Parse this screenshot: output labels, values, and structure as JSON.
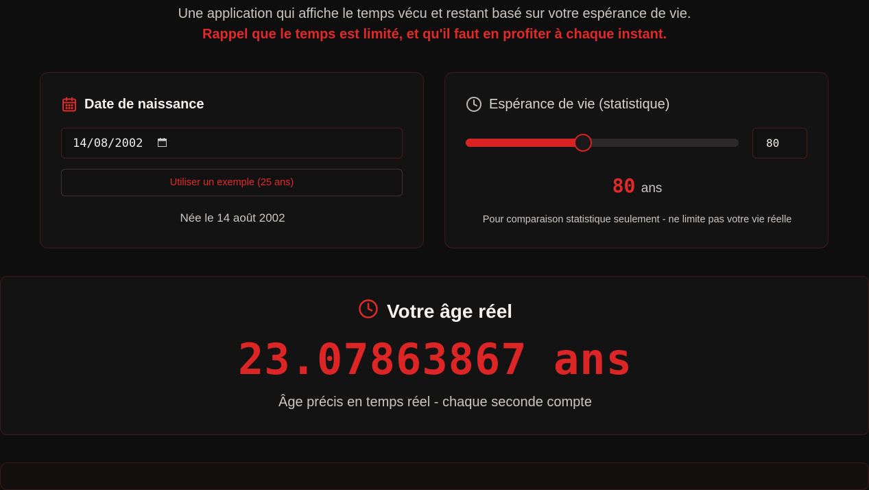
{
  "intro": {
    "description": "Une application qui affiche le temps vécu et restant basé sur votre espérance de vie.",
    "reminder": "Rappel que le temps est limité, et qu'il faut en profiter à chaque instant."
  },
  "birth_card": {
    "title": "Date de naissance",
    "date_value": "14/08/2002",
    "example_button": "Utiliser un exemple (25 ans)",
    "born_text": "Née le 14 août 2002"
  },
  "life_card": {
    "title": "Espérance de vie (statistique)",
    "slider_value": 80,
    "slider_fraction": 0.43,
    "input_value": "80",
    "display_number": "80",
    "display_unit": "ans",
    "note": "Pour comparaison statistique seulement - ne limite pas votre vie réelle"
  },
  "age_card": {
    "title": "Votre âge réel",
    "value": "23.07863867 ans",
    "subtitle": "Âge précis en temps réel - chaque seconde compte"
  },
  "colors": {
    "accent": "#dc2626",
    "background": "#0f0e0e",
    "card": "#141313"
  },
  "icons": {
    "birth": "calendar-icon",
    "life": "clock-icon",
    "age": "clock-icon"
  }
}
